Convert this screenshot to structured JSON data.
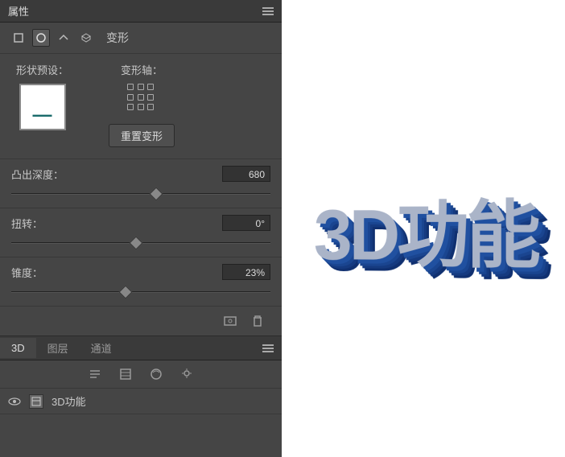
{
  "panel": {
    "title": "属性"
  },
  "toolbar": {
    "deform_label": "变形"
  },
  "presets": {
    "shape_label": "形状预设：",
    "axis_label": "变形轴：",
    "reset_label": "重置变形"
  },
  "sliders": {
    "depth": {
      "label": "凸出深度：",
      "value": "680",
      "pos": 56
    },
    "twist": {
      "label": "扭转：",
      "value": "0°",
      "pos": 48
    },
    "taper": {
      "label": "锥度：",
      "value": "23%",
      "pos": 44
    }
  },
  "tabs": {
    "items": [
      {
        "label": "3D",
        "active": true
      },
      {
        "label": "图层",
        "active": false
      },
      {
        "label": "通道",
        "active": false
      }
    ]
  },
  "layer": {
    "name": "3D功能"
  },
  "preview": {
    "text": "3D功能"
  }
}
